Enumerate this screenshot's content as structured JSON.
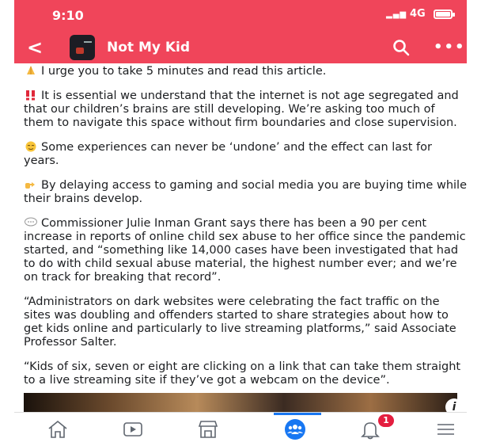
{
  "status_bar": {
    "time": "9:10",
    "network": "4G"
  },
  "header": {
    "group_name": "Not My Kid"
  },
  "post": {
    "paragraphs": [
      {
        "emoji": "pray-emoji",
        "text": "I urge you to take 5 minutes and read this article."
      },
      {
        "emoji": "double-exclamation-emoji",
        "text": "It is essential we understand that the internet is not age segregated and that our children’s brains are still developing. We’re asking too much of them to navigate this space without firm boundaries and close supervision."
      },
      {
        "emoji": "relieved-face-emoji",
        "text": "Some experiences can never be ‘undone’ and the effect can last for years."
      },
      {
        "emoji": "pointing-hand-emoji",
        "text": "By delaying access to gaming and social media you are buying time while their brains develop."
      },
      {
        "emoji": "speech-bubble-emoji",
        "text": "Commissioner Julie Inman Grant says there has been a 90 per cent increase in reports of online child sex abuse to her office since the pandemic started, and “something like 14,000 cases have been investigated that had to do with child sexual abuse material, the highest number ever; and we’re on track for breaking that record”."
      },
      {
        "emoji": "",
        "text": "“Administrators on dark websites were celebrating the fact traffic on the sites was doubling and offenders started to share strategies about how to get kids online and particularly to live streaming platforms,” said Associate Professor Salter."
      },
      {
        "emoji": "",
        "text": "“Kids of six, seven or eight are clicking on a link that can take them straight to a live streaming site if they’ve got a webcam on the device”."
      }
    ]
  },
  "media": {
    "info_icon": "i"
  },
  "tabbar": {
    "tabs": [
      {
        "name": "home",
        "icon": "home-icon"
      },
      {
        "name": "watch",
        "icon": "video-icon"
      },
      {
        "name": "marketplace",
        "icon": "store-icon"
      },
      {
        "name": "groups",
        "icon": "groups-icon",
        "active": true
      },
      {
        "name": "notifications",
        "icon": "bell-icon",
        "badge": "1"
      },
      {
        "name": "menu",
        "icon": "menu-icon"
      }
    ]
  },
  "colors": {
    "brand_red": "#f0455a",
    "active_blue": "#1877f2",
    "badge_red": "#e41e3f"
  }
}
